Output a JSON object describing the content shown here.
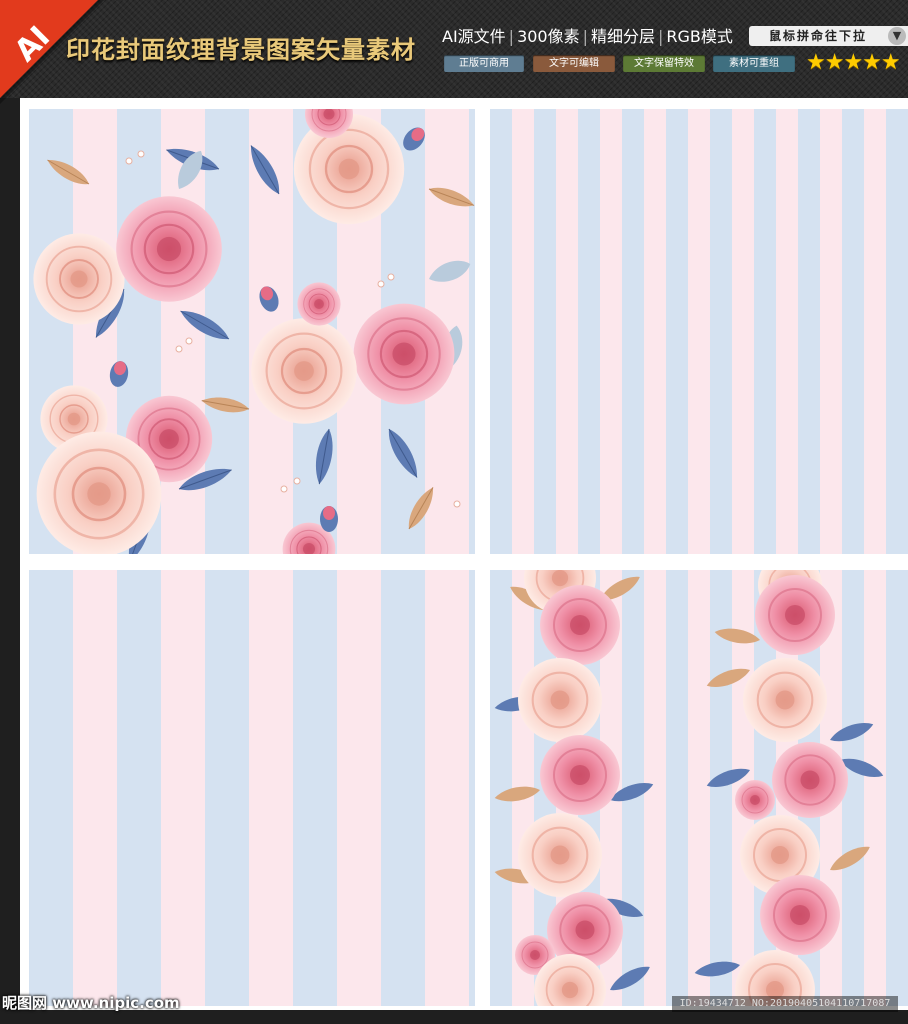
{
  "header": {
    "corner_label": "AI",
    "title": "印花封面纹理背景图案矢量素材",
    "specs": [
      "AI源文件",
      "300像素",
      "精细分层",
      "RGB模式"
    ],
    "tags": [
      {
        "label": "正版可商用",
        "color": "#5f7d92"
      },
      {
        "label": "文字可编辑",
        "color": "#8a5a3c"
      },
      {
        "label": "文字保留特效",
        "color": "#5d7a35"
      },
      {
        "label": "素材可重组",
        "color": "#3f6f80"
      }
    ],
    "drag_hint": "鼠标拼命往下拉",
    "stars": "★★★★★",
    "rating": 5
  },
  "colors": {
    "stripe_blue": "#d5e2f1",
    "stripe_pink": "#fce7ec",
    "rose_pink": "#ef8fa6",
    "rose_peach": "#f9cfc4",
    "leaf_blue": "#5d7bb3",
    "leaf_tan": "#d9a77d"
  },
  "panels": [
    {
      "name": "floral-pattern-panel",
      "pattern": "roses on vertical stripes"
    },
    {
      "name": "plain-stripe-panel-narrow",
      "pattern": "narrow vertical stripes"
    },
    {
      "name": "plain-stripe-panel-wide",
      "pattern": "wide vertical stripes"
    },
    {
      "name": "floral-border-panel",
      "pattern": "rose vertical borders on stripes"
    }
  ],
  "footer": {
    "logo": "昵图网 www.nipic.com",
    "id_text": "ID:19434712 NO:20190405104110717087"
  }
}
